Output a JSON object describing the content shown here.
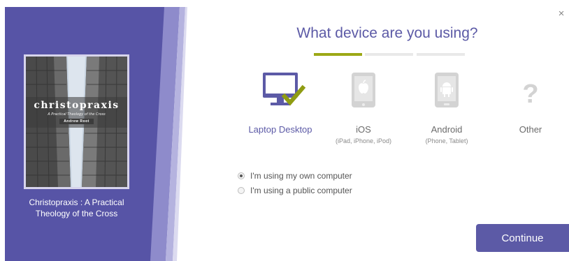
{
  "dialog": {
    "title": "What device are you using?",
    "close_glyph": "×",
    "progress_steps": [
      {
        "state": "active"
      },
      {
        "state": "inactive"
      },
      {
        "state": "inactive"
      }
    ]
  },
  "book": {
    "caption": "Christopraxis : A Practical Theology of the Cross",
    "cover_title": "christopraxis",
    "cover_subtitle": "A Practical Theology of the Cross",
    "cover_author": "Andrew Root"
  },
  "devices": [
    {
      "label": "Laptop Desktop",
      "sub": "",
      "icon": "laptop-desktop-icon",
      "selected": true
    },
    {
      "label": "iOS",
      "sub": "(iPad, iPhone, iPod)",
      "icon": "apple-tablet-icon",
      "selected": false
    },
    {
      "label": "Android",
      "sub": "(Phone, Tablet)",
      "icon": "android-tablet-icon",
      "selected": false
    },
    {
      "label": "Other",
      "sub": "",
      "icon": "question-mark-icon",
      "selected": false
    }
  ],
  "computer_type": {
    "options": [
      {
        "label": "I'm using my own computer",
        "checked": true
      },
      {
        "label": "I'm using a public computer",
        "checked": false
      }
    ]
  },
  "continue_label": "Continue",
  "colors": {
    "brand_purple": "#5c5aa6",
    "accent_green": "#9ca816",
    "panel_dark": "#5754a6",
    "panel_light": "#9c99d3"
  }
}
